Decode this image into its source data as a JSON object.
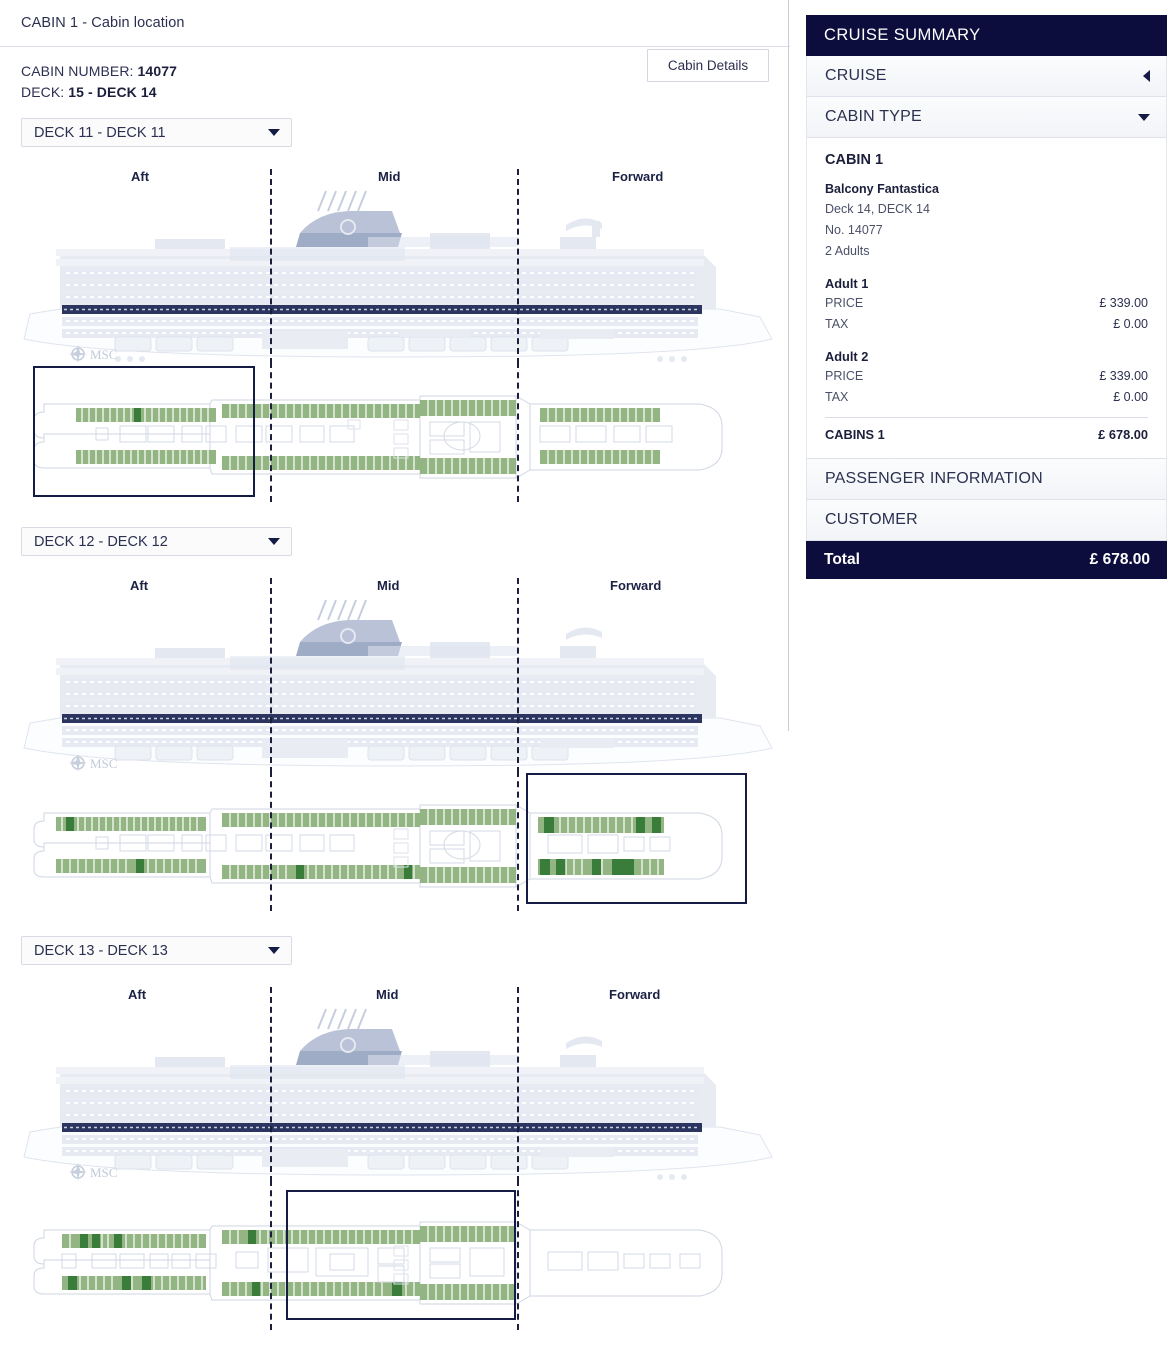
{
  "left": {
    "panel_title": "CABIN 1 - Cabin location",
    "cabin_number_label": "CABIN NUMBER:",
    "cabin_number_value": "14077",
    "deck_label": "DECK:",
    "deck_value": "15 - DECK 14",
    "cabin_details_label": "Cabin Details",
    "sections": {
      "aft": "Aft",
      "mid": "Mid",
      "forward": "Forward"
    },
    "ship_brand": "MSC",
    "decks": [
      {
        "selector_label": "DECK 11 - DECK 11",
        "selection_region": "aft"
      },
      {
        "selector_label": "DECK 12 - DECK 12",
        "selection_region": "forward"
      },
      {
        "selector_label": "DECK 13 - DECK 13",
        "selection_region": "mid"
      }
    ]
  },
  "sidebar": {
    "header": "CRUISE SUMMARY",
    "accordions": [
      {
        "label": "CRUISE",
        "icon": "triangle-left-icon",
        "expanded": false
      },
      {
        "label": "CABIN TYPE",
        "icon": "triangle-down-icon",
        "expanded": true
      }
    ],
    "cabin": {
      "title": "CABIN 1",
      "type": "Balcony Fantastica",
      "deck": "Deck 14, DECK 14",
      "number": "No. 14077",
      "occupancy": "2 Adults",
      "guests": [
        {
          "name": "Adult 1",
          "price_label": "PRICE",
          "price_value": "£ 339.00",
          "tax_label": "TAX",
          "tax_value": "£ 0.00"
        },
        {
          "name": "Adult 2",
          "price_label": "PRICE",
          "price_value": "£ 339.00",
          "tax_label": "TAX",
          "tax_value": "£ 0.00"
        }
      ],
      "subtotal_label": "CABINS 1",
      "subtotal_value": "£ 678.00"
    },
    "sections_collapsed": [
      {
        "label": "PASSENGER INFORMATION"
      },
      {
        "label": "CUSTOMER"
      }
    ],
    "total_label": "Total",
    "total_value": "£ 678.00"
  },
  "colors": {
    "navy": "#0d0d3d",
    "cabin_available": "#93b583",
    "cabin_selected": "#3a7d3a",
    "ship_light": "#e8ebf2",
    "deck_highlight": "#2b3560"
  }
}
